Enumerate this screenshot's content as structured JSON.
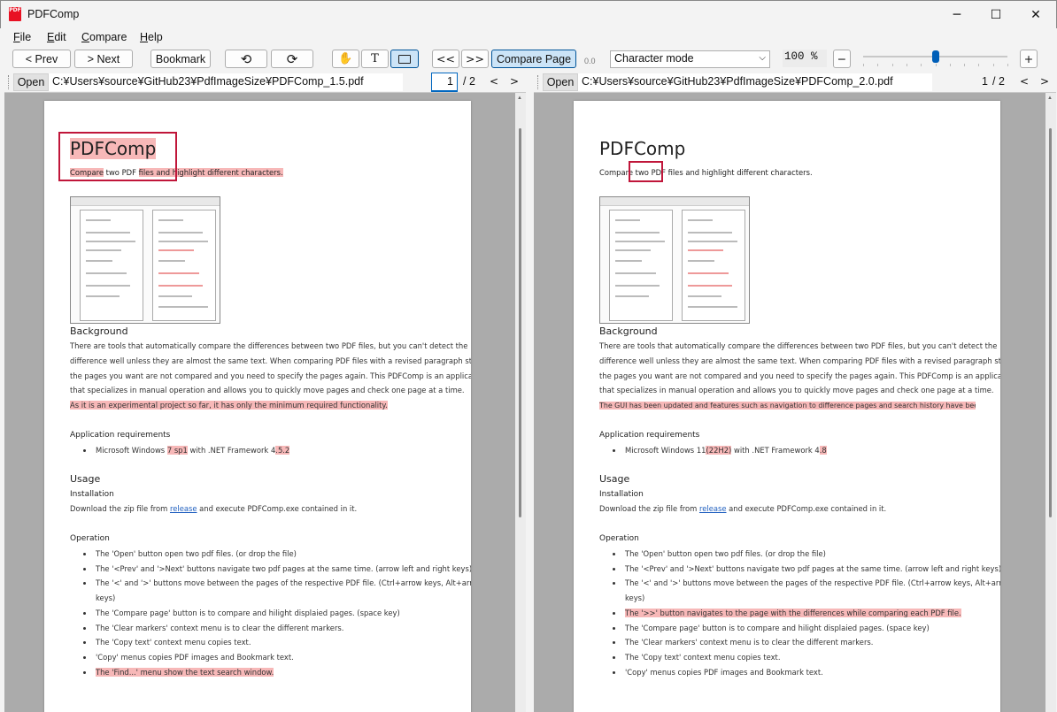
{
  "window": {
    "title": "PDFComp",
    "icon_text": "PDF",
    "minimize": "─",
    "maximize": "☐",
    "close": "✕"
  },
  "menu": [
    {
      "key": "F",
      "rest": "ile"
    },
    {
      "key": "E",
      "rest": "dit"
    },
    {
      "key": "C",
      "rest": "ompare"
    },
    {
      "key": "H",
      "rest": "elp"
    }
  ],
  "toolbar": {
    "prev": "< Prev",
    "next": "> Next",
    "bookmark": "Bookmark",
    "rotate_left_icon": "⟲",
    "rotate_right_icon": "⟳",
    "hand_icon": "✋",
    "text_tool": "T",
    "first_icon": "<<",
    "last_icon": ">>",
    "compare_page": "Compare Page",
    "dim_value": "0.0",
    "mode": "Character mode",
    "zoom": "100 %",
    "zoom_out": "−",
    "zoom_in": "+",
    "zoom_slider_fraction": 0.5
  },
  "left": {
    "open": "Open",
    "path": "C:¥Users¥source¥GitHub23¥PdfImageSize¥PDFComp_1.5.pdf",
    "page_current": "1",
    "page_total": "/  2",
    "prev": "<",
    "next": ">"
  },
  "right": {
    "open": "Open",
    "path": "C:¥Users¥source¥GitHub23¥PdfImageSize¥PDFComp_2.0.pdf",
    "page_current": "1",
    "page_total": "/  2",
    "prev": "<",
    "next": ">"
  },
  "doc": {
    "title": "PDFComp",
    "subtitle_a": "Compare",
    "subtitle_b": " two PDF ",
    "subtitle_c": "files and highlight different characters.",
    "background": "Background",
    "bg1": "There are tools that automatically compare the differences between two PDF files, but you can't detect the",
    "bg2": "difference well unless they are almost the same text. When comparing PDF files with a revised paragraph structure,",
    "bg3": "the pages you want are not compared and you need to specify the pages again. This PDFComp is an application",
    "bg4": "that specializes in manual operation and allows you to quickly move pages and check one page at a time.",
    "bg5_left": "As it is an experimental project so far, it has only the minimum required functionality.",
    "bg5_right": "The GUI has been updated and features such as navigation to difference pages and search history have been added.",
    "app_req": "Application requirements",
    "req_left_a": "Microsoft Windows ",
    "req_left_b": "7 sp1",
    "req_left_c": " with .NET Framework 4",
    "req_left_d": ".5.2",
    "req_right_a": "Microsoft Windows 11",
    "req_right_b": "(22H2)",
    "req_right_c": " with .NET Framework 4",
    "req_right_d": ".8",
    "usage": "Usage",
    "installation": "Installation",
    "dl_a": "Download the zip file from ",
    "dl_link": "release",
    "dl_b": " and execute PDFComp.exe contained in it.",
    "operation": "Operation",
    "op1": "The 'Open' button open two pdf files.    (or drop the file)",
    "op2": "The '<Prev' and '>Next' buttons navigate two pdf pages at the same time. (arrow left and right keys)",
    "op3": "The '<' and '>' buttons move between the pages of the respective PDF file. (Ctrl+arrow keys, Alt+arrow",
    "op3b": "keys)",
    "op_new": "The '>>' button navigates to the page with the differences while comparing each PDF file.",
    "op4": "The 'Compare page' button is to compare and hilight displaied pages. (space key)",
    "op5": "The 'Clear markers' context menu is to clear the different markers.",
    "op6": "The 'Copy text' context menu copies text.",
    "op7": "'Copy' menus copies PDF images and Bookmark text.",
    "op8": "The 'Find...' menu show the text search window."
  }
}
